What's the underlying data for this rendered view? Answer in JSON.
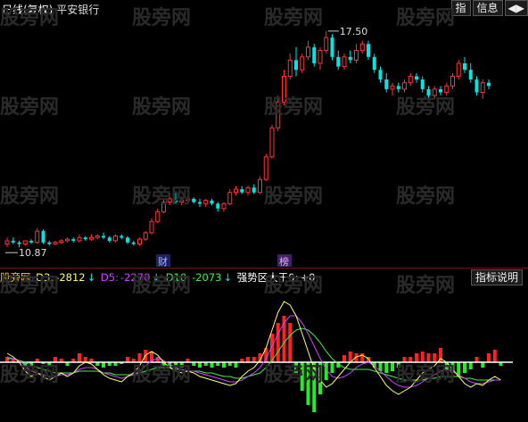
{
  "header": {
    "period_label": "日线(复权)",
    "stock_name": "平安银行",
    "btn_index": "指",
    "btn_info": "信息",
    "btn_arrows": "◀▶"
  },
  "main_chart": {
    "high_label": "17.50",
    "low_label": "10.87",
    "marker_cai": "财",
    "marker_bang": "榜"
  },
  "indicator": {
    "name": "股旁网",
    "d3_label": "D3:",
    "d3_value": "-2812",
    "d5_label": "D5:",
    "d5_value": "-2270",
    "d10_label": "D10:",
    "d10_value": "-2073",
    "strong_text": "强势区大于0:",
    "strong_value": "+0",
    "explain_button": "指标说明"
  },
  "watermark": "股旁网",
  "colors": {
    "up": "#ff3333",
    "down": "#00e5e5",
    "d3": "#ffff66",
    "d5": "#cc44ff",
    "d10": "#44ee44",
    "bar_pos": "#ff2222",
    "bar_neg": "#22ee22"
  },
  "chart_data": {
    "type": "candlestick",
    "candles": [
      [
        10.9,
        11.1,
        10.8,
        11.0
      ],
      [
        11.0,
        11.1,
        10.9,
        10.95
      ],
      [
        10.95,
        11.0,
        10.8,
        10.9
      ],
      [
        10.9,
        11.0,
        10.85,
        11.0
      ],
      [
        11.0,
        11.05,
        10.9,
        10.95
      ],
      [
        10.95,
        11.4,
        10.9,
        11.3
      ],
      [
        11.3,
        11.35,
        10.9,
        10.95
      ],
      [
        10.95,
        11.0,
        10.85,
        10.9
      ],
      [
        10.9,
        11.0,
        10.87,
        10.95
      ],
      [
        10.95,
        11.05,
        10.9,
        11.0
      ],
      [
        11.0,
        11.1,
        10.95,
        11.05
      ],
      [
        11.05,
        11.1,
        10.95,
        11.0
      ],
      [
        11.0,
        11.2,
        10.95,
        11.1
      ],
      [
        11.1,
        11.15,
        11.0,
        11.05
      ],
      [
        11.05,
        11.2,
        11.0,
        11.1
      ],
      [
        11.1,
        11.2,
        11.05,
        11.15
      ],
      [
        11.15,
        11.25,
        11.05,
        11.1
      ],
      [
        11.1,
        11.15,
        10.95,
        11.0
      ],
      [
        11.0,
        11.2,
        10.95,
        11.15
      ],
      [
        11.15,
        11.2,
        11.05,
        11.1
      ],
      [
        11.1,
        11.15,
        10.9,
        10.95
      ],
      [
        10.95,
        11.0,
        10.85,
        10.9
      ],
      [
        10.9,
        11.1,
        10.85,
        11.05
      ],
      [
        11.05,
        11.3,
        11.0,
        11.25
      ],
      [
        11.25,
        11.7,
        11.2,
        11.6
      ],
      [
        11.6,
        12.0,
        11.55,
        11.9
      ],
      [
        11.9,
        12.3,
        11.85,
        12.2
      ],
      [
        12.2,
        12.5,
        12.1,
        12.3
      ],
      [
        12.3,
        12.5,
        12.15,
        12.2
      ],
      [
        12.2,
        12.35,
        12.1,
        12.25
      ],
      [
        12.25,
        12.4,
        12.15,
        12.3
      ],
      [
        12.3,
        12.35,
        12.15,
        12.2
      ],
      [
        12.2,
        12.3,
        12.05,
        12.15
      ],
      [
        12.15,
        12.3,
        12.05,
        12.25
      ],
      [
        12.25,
        12.3,
        12.1,
        12.15
      ],
      [
        12.15,
        12.2,
        11.9,
        12.0
      ],
      [
        12.0,
        12.2,
        11.9,
        12.15
      ],
      [
        12.15,
        12.6,
        12.1,
        12.5
      ],
      [
        12.5,
        12.7,
        12.4,
        12.6
      ],
      [
        12.6,
        12.7,
        12.45,
        12.5
      ],
      [
        12.5,
        12.7,
        12.4,
        12.65
      ],
      [
        12.65,
        12.75,
        12.45,
        12.5
      ],
      [
        12.5,
        13.0,
        12.45,
        12.9
      ],
      [
        12.9,
        13.7,
        12.85,
        13.6
      ],
      [
        13.6,
        14.6,
        13.55,
        14.5
      ],
      [
        14.5,
        15.5,
        14.4,
        15.3
      ],
      [
        15.3,
        16.3,
        15.2,
        16.1
      ],
      [
        16.1,
        16.8,
        16.0,
        16.6
      ],
      [
        16.6,
        17.0,
        16.1,
        16.3
      ],
      [
        16.3,
        16.8,
        16.2,
        16.7
      ],
      [
        16.7,
        17.2,
        16.6,
        17.0
      ],
      [
        17.0,
        17.1,
        16.4,
        16.5
      ],
      [
        16.5,
        17.0,
        16.3,
        16.9
      ],
      [
        16.9,
        17.5,
        16.8,
        17.3
      ],
      [
        17.3,
        17.4,
        16.6,
        16.7
      ],
      [
        16.7,
        16.9,
        16.3,
        16.4
      ],
      [
        16.4,
        16.8,
        16.3,
        16.7
      ],
      [
        16.7,
        16.9,
        16.5,
        16.6
      ],
      [
        16.6,
        17.1,
        16.5,
        16.9
      ],
      [
        16.9,
        17.2,
        16.8,
        17.1
      ],
      [
        17.1,
        17.2,
        16.6,
        16.7
      ],
      [
        16.7,
        16.8,
        16.2,
        16.3
      ],
      [
        16.3,
        16.4,
        15.9,
        16.0
      ],
      [
        16.0,
        16.2,
        15.6,
        15.7
      ],
      [
        15.7,
        15.9,
        15.5,
        15.8
      ],
      [
        15.8,
        15.9,
        15.6,
        15.7
      ],
      [
        15.7,
        16.0,
        15.6,
        15.9
      ],
      [
        15.9,
        16.2,
        15.8,
        16.1
      ],
      [
        16.1,
        16.2,
        15.9,
        16.0
      ],
      [
        16.0,
        16.1,
        15.6,
        15.7
      ],
      [
        15.7,
        15.8,
        15.4,
        15.5
      ],
      [
        15.5,
        15.8,
        15.4,
        15.7
      ],
      [
        15.7,
        15.8,
        15.5,
        15.6
      ],
      [
        15.6,
        15.9,
        15.5,
        15.8
      ],
      [
        15.8,
        16.2,
        15.7,
        16.1
      ],
      [
        16.1,
        16.6,
        16.0,
        16.5
      ],
      [
        16.5,
        16.7,
        16.2,
        16.3
      ],
      [
        16.3,
        16.5,
        15.9,
        16.0
      ],
      [
        16.0,
        16.1,
        15.5,
        15.6
      ],
      [
        15.6,
        16.0,
        15.4,
        15.9
      ],
      [
        15.9,
        16.0,
        15.7,
        15.8
      ]
    ],
    "oscillator": {
      "bars": [
        0.3,
        0.2,
        0.1,
        -0.3,
        -0.2,
        0.2,
        -0.1,
        -0.2,
        0.3,
        0.2,
        -0.2,
        0.2,
        0.5,
        0.3,
        0.2,
        -0.2,
        -0.3,
        -0.2,
        -0.2,
        -0.1,
        0.3,
        0.2,
        0.5,
        0.7,
        0.6,
        0.3,
        -0.2,
        -0.3,
        -0.2,
        -0.3,
        0.2,
        -0.2,
        -0.3,
        -0.2,
        -0.3,
        -0.2,
        -0.3,
        -0.2,
        -0.3,
        0.2,
        0.3,
        0.3,
        0.5,
        0.8,
        1.6,
        2.2,
        2.6,
        2.2,
        -0.6,
        -1.6,
        -2.4,
        -2.8,
        -1.8,
        -1.0,
        -0.6,
        -0.3,
        0.4,
        0.6,
        0.5,
        0.5,
        0.3,
        -0.3,
        -0.5,
        -0.6,
        -0.5,
        -0.3,
        0.3,
        0.3,
        0.5,
        0.6,
        0.5,
        0.5,
        0.8,
        -0.4,
        -0.6,
        -0.8,
        -0.6,
        -0.4,
        0.3,
        -0.3,
        0.5,
        0.7,
        -0.2
      ],
      "d3": [
        0.5,
        0.3,
        0,
        -0.5,
        -0.8,
        -0.6,
        -0.8,
        -1.0,
        -0.8,
        -0.6,
        -0.8,
        -0.6,
        -0.2,
        0,
        -0.1,
        -0.4,
        -0.7,
        -0.9,
        -1.0,
        -1.1,
        -0.8,
        -0.6,
        -0.2,
        0.4,
        0.6,
        0.4,
        0,
        -0.3,
        -0.5,
        -0.6,
        -0.5,
        -0.6,
        -0.8,
        -0.9,
        -1.0,
        -1.1,
        -1.2,
        -1.3,
        -1.2,
        -0.8,
        -0.5,
        -0.3,
        0.1,
        0.8,
        1.8,
        2.8,
        3.4,
        3.2,
        2.6,
        1.6,
        0.6,
        -0.4,
        -1.0,
        -1.4,
        -1.2,
        -0.8,
        -0.4,
        0,
        0.3,
        0.4,
        0.2,
        -0.3,
        -0.8,
        -1.3,
        -1.6,
        -1.8,
        -1.6,
        -1.4,
        -1.0,
        -0.6,
        -0.4,
        -0.2,
        0.2,
        0,
        -0.4,
        -0.8,
        -1.2,
        -1.4,
        -1.2,
        -1.3,
        -1.0,
        -0.8,
        -1.0
      ],
      "d5": [
        0.3,
        0.2,
        0.1,
        -0.2,
        -0.5,
        -0.6,
        -0.7,
        -0.8,
        -0.8,
        -0.7,
        -0.7,
        -0.6,
        -0.4,
        -0.3,
        -0.3,
        -0.4,
        -0.6,
        -0.7,
        -0.8,
        -0.9,
        -0.8,
        -0.7,
        -0.5,
        -0.2,
        0.1,
        0.2,
        0.1,
        -0.1,
        -0.3,
        -0.4,
        -0.5,
        -0.5,
        -0.6,
        -0.7,
        -0.8,
        -0.9,
        -1.0,
        -1.1,
        -1.1,
        -1.0,
        -0.8,
        -0.6,
        -0.3,
        0.2,
        0.9,
        1.6,
        2.2,
        2.6,
        2.6,
        2.2,
        1.6,
        0.9,
        0.2,
        -0.4,
        -0.8,
        -0.9,
        -0.8,
        -0.6,
        -0.3,
        -0.1,
        0,
        -0.2,
        -0.5,
        -0.8,
        -1.1,
        -1.3,
        -1.4,
        -1.4,
        -1.3,
        -1.1,
        -0.9,
        -0.7,
        -0.5,
        -0.4,
        -0.5,
        -0.7,
        -0.9,
        -1.1,
        -1.2,
        -1.2,
        -1.1,
        -1.0,
        -1.0
      ],
      "d10": [
        0.2,
        0.2,
        0.1,
        0,
        -0.2,
        -0.3,
        -0.4,
        -0.5,
        -0.6,
        -0.6,
        -0.6,
        -0.6,
        -0.5,
        -0.5,
        -0.5,
        -0.5,
        -0.6,
        -0.6,
        -0.7,
        -0.7,
        -0.7,
        -0.7,
        -0.6,
        -0.5,
        -0.4,
        -0.3,
        -0.3,
        -0.3,
        -0.4,
        -0.4,
        -0.5,
        -0.5,
        -0.5,
        -0.6,
        -0.6,
        -0.7,
        -0.8,
        -0.8,
        -0.9,
        -0.9,
        -0.8,
        -0.7,
        -0.6,
        -0.3,
        0.1,
        0.6,
        1.1,
        1.5,
        1.8,
        1.9,
        1.8,
        1.5,
        1.1,
        0.6,
        0.2,
        -0.1,
        -0.3,
        -0.4,
        -0.4,
        -0.4,
        -0.4,
        -0.5,
        -0.6,
        -0.7,
        -0.8,
        -0.9,
        -1.0,
        -1.0,
        -1.0,
        -1.0,
        -0.9,
        -0.9,
        -0.8,
        -0.8,
        -0.8,
        -0.8,
        -0.9,
        -0.9,
        -1.0,
        -1.0,
        -1.0,
        -1.0,
        -1.0
      ]
    }
  }
}
